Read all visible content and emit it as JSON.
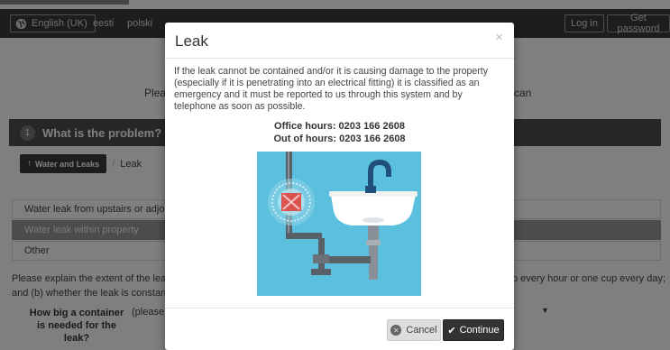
{
  "nav": {
    "current_language": "English (UK)",
    "languages": [
      "eesti",
      "polski"
    ],
    "login_label": "Log in",
    "get_password_label": "Get password"
  },
  "intro": {
    "left_fragment": "Plea",
    "right_fragment": "can"
  },
  "section": {
    "number": "1",
    "title": "What is the problem?"
  },
  "breadcrumb": {
    "parent_label": "Water and Leaks",
    "current_label": "Leak"
  },
  "options": [
    "Water leak from upstairs or adjoining pr",
    "Water leak within property",
    "Other"
  ],
  "explain": {
    "line1_left": "Please explain the extent of the leak by re",
    "line1_right": "one cup every hour or one cup every day;",
    "line2_left": "and (b) whether the leak is constant or in"
  },
  "question": {
    "label": "How big a container is needed for the leak?",
    "select_value": "(please"
  },
  "modal": {
    "title": "Leak",
    "close_symbol": "×",
    "message": "If the leak cannot be contained and/or it is causing damage to the property (especially if it is penetrating into an electrical fitting) it is classified as an emergency and it must be reported to us through this system and by telephone as soon as possible.",
    "office_hours": "Office hours: 0203 166 2608",
    "out_of_hours": "Out of hours: 0203 166 2608",
    "cancel_label": "Cancel",
    "continue_label": "Continue"
  },
  "colors": {
    "navbar": "#3a3a3a",
    "section_header": "#4f4f4f",
    "selected_option": "#999999",
    "illustration_bg": "#5bc0de",
    "continue_button": "#333333"
  },
  "icons": {
    "language": "globe-icon",
    "crumb": "arrow-up-icon",
    "cancel": "times-circle-icon",
    "continue": "check-icon",
    "select": "caret-down-icon"
  }
}
